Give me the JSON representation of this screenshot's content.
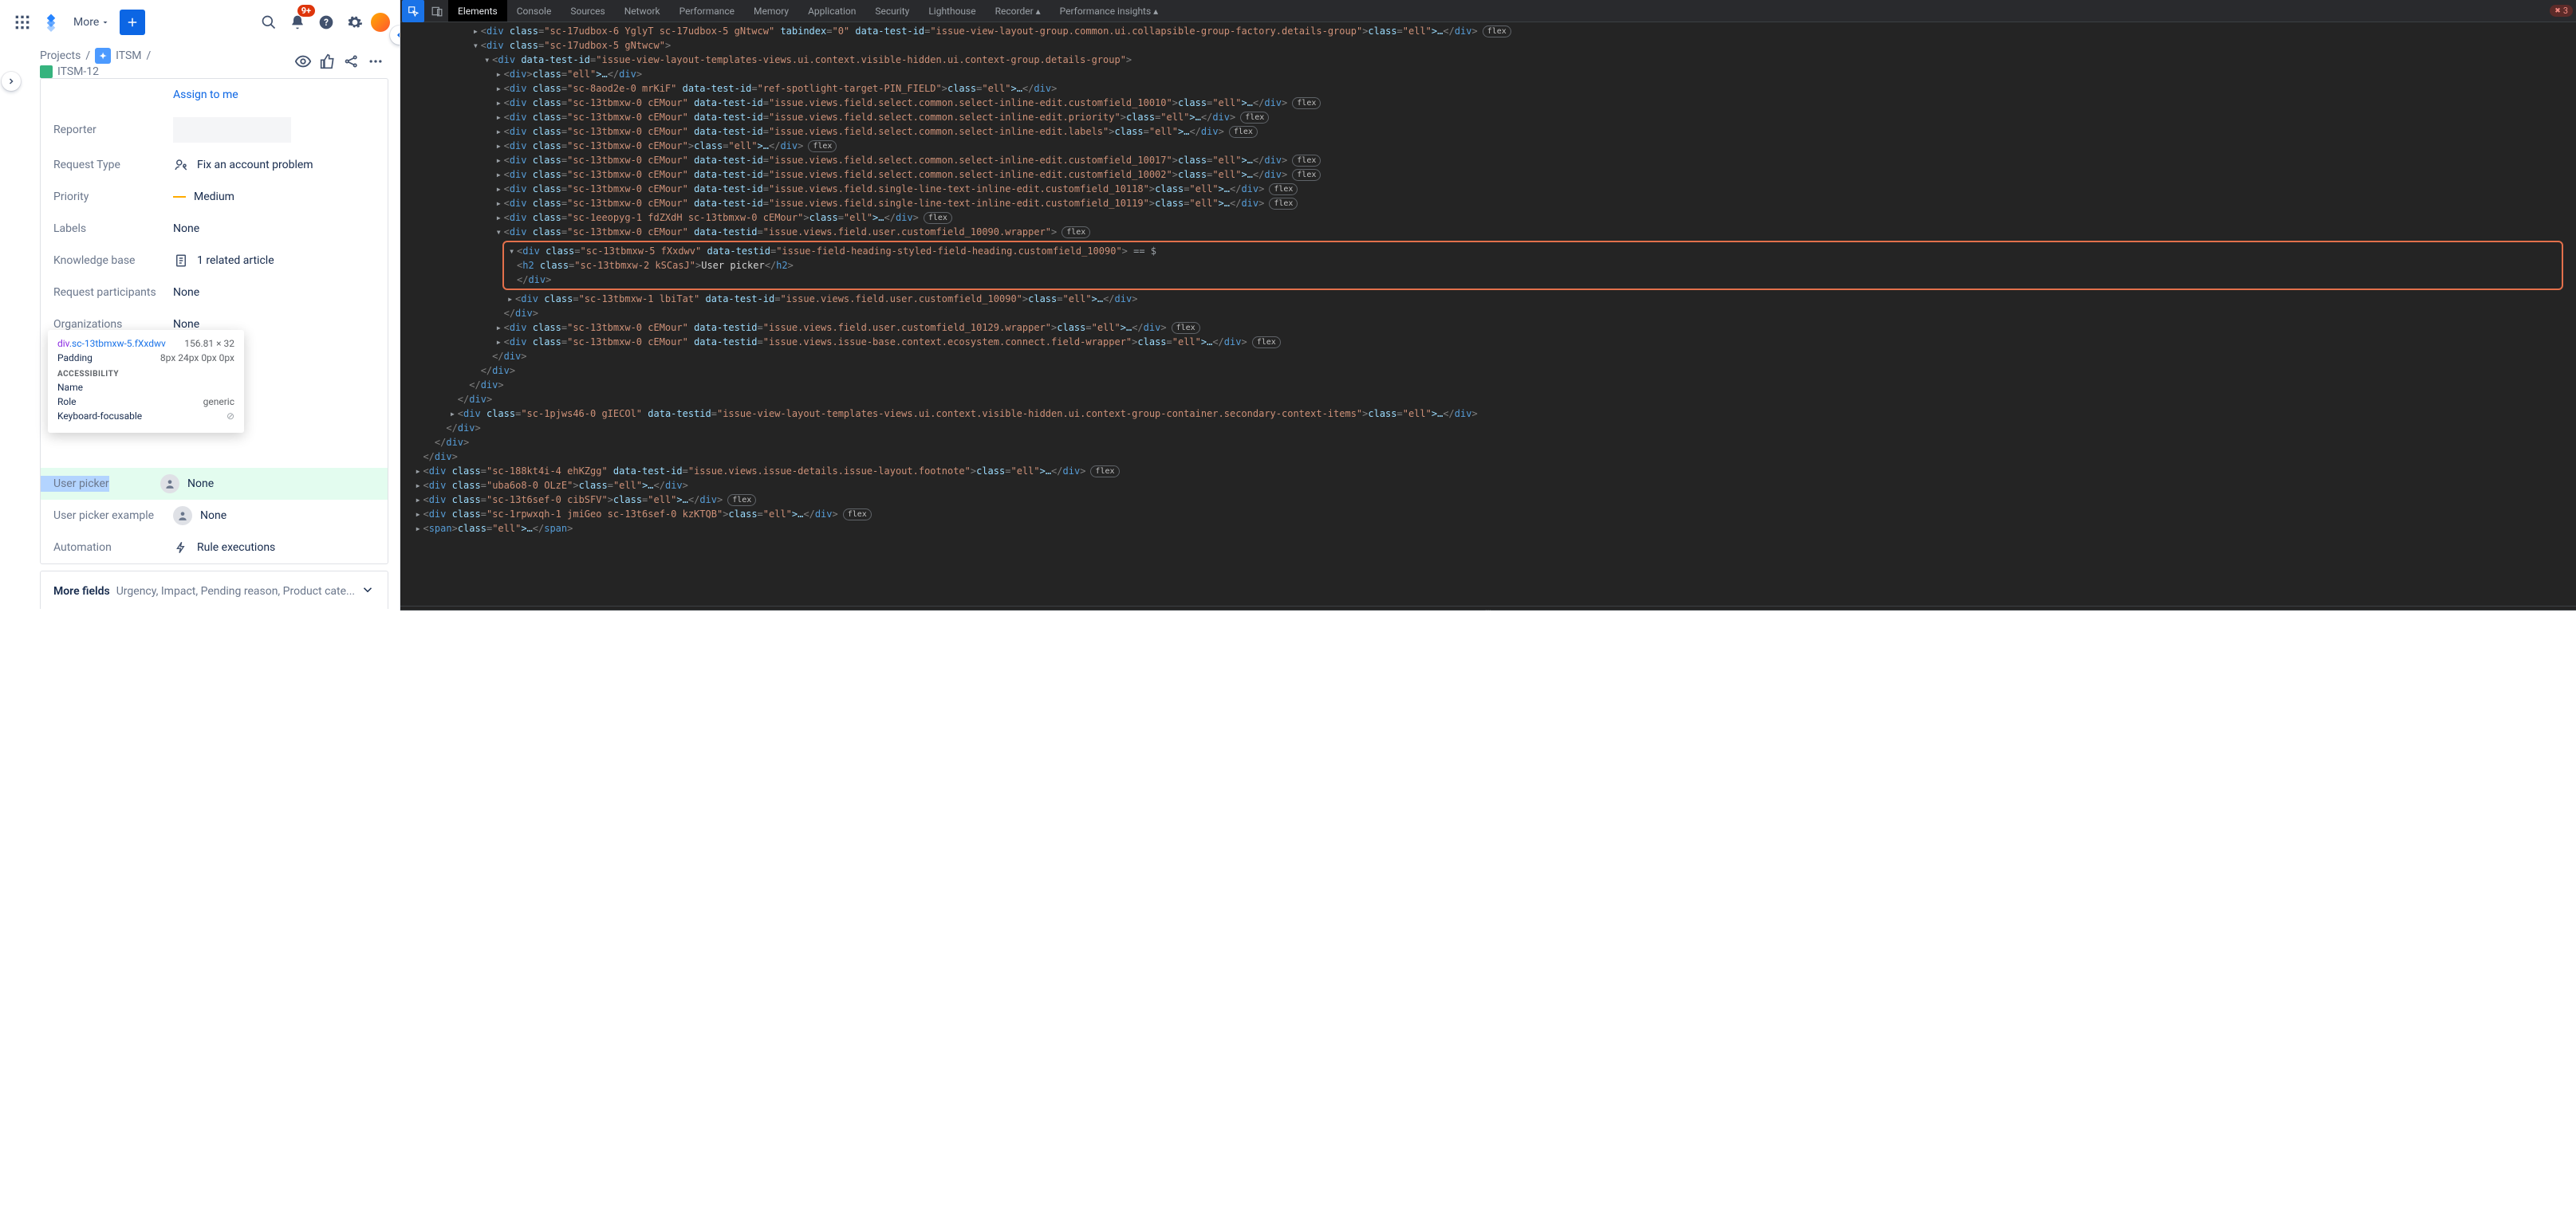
{
  "topbar": {
    "more": "More",
    "notif_badge": "9+"
  },
  "breadcrumb": {
    "projects": "Projects",
    "project_name": "ITSM",
    "issue_key": "ITSM-12"
  },
  "fields": {
    "assignee_label": "Assign to me",
    "reporter": {
      "label": "Reporter"
    },
    "request_type": {
      "label": "Request Type",
      "value": "Fix an account problem"
    },
    "priority": {
      "label": "Priority",
      "value": "Medium"
    },
    "labels": {
      "label": "Labels",
      "value": "None"
    },
    "knowledge": {
      "label": "Knowledge base",
      "value": "1 related article"
    },
    "participants": {
      "label": "Request participants",
      "value": "None"
    },
    "orgs": {
      "label": "Organizations",
      "value": "None"
    },
    "user_picker": {
      "label": "User picker",
      "value": "None"
    },
    "user_picker_ex": {
      "label": "User picker example",
      "value": "None"
    },
    "automation": {
      "label": "Automation",
      "value": "Rule executions"
    }
  },
  "more_fields": {
    "title": "More fields",
    "subtitle": "Urgency, Impact, Pending reason, Product cate..."
  },
  "tooltip": {
    "selector_prefix": "div",
    "selector_class": ".sc-13tbmxw-5.fXxdwv",
    "dims": "156.81 × 32",
    "padding_label": "Padding",
    "padding_value": "8px 24px 0px 0px",
    "a11y": "ACCESSIBILITY",
    "name_label": "Name",
    "role_label": "Role",
    "role_value": "generic",
    "focus_label": "Keyboard-focusable"
  },
  "devtools": {
    "tabs": [
      "Elements",
      "Console",
      "Sources",
      "Network",
      "Performance",
      "Memory",
      "Application",
      "Security",
      "Lighthouse",
      "Recorder ▴",
      "Performance insights ▴"
    ],
    "active_tab": 0,
    "error_count": "3"
  },
  "dom_lines": [
    {
      "indent": 6,
      "arrow": "▸",
      "html": "<div class=\"sc-17udbox-6 YglyT sc-17udbox-5 gNtwcw\" tabindex=\"0\" data-test-id=\"issue-view-layout-group.common.ui.collapsible-group-factory.details-group\">…</div>",
      "pill": "flex"
    },
    {
      "indent": 6,
      "arrow": "▾",
      "html": "<div class=\"sc-17udbox-5 gNtwcw\">"
    },
    {
      "indent": 7,
      "arrow": "▾",
      "html": "<div data-test-id=\"issue-view-layout-templates-views.ui.context.visible-hidden.ui.context-group.details-group\">"
    },
    {
      "indent": 8,
      "arrow": "▸",
      "html": "<div>…</div>"
    },
    {
      "indent": 8,
      "arrow": "▸",
      "html": "<div class=\"sc-8aod2e-0 mrKiF\" data-test-id=\"ref-spotlight-target-PIN_FIELD\">…</div>"
    },
    {
      "indent": 8,
      "arrow": "▸",
      "html": "<div class=\"sc-13tbmxw-0 cEMour\" data-test-id=\"issue.views.field.select.common.select-inline-edit.customfield_10010\">…</div>",
      "pill": "flex"
    },
    {
      "indent": 8,
      "arrow": "▸",
      "html": "<div class=\"sc-13tbmxw-0 cEMour\" data-test-id=\"issue.views.field.select.common.select-inline-edit.priority\">…</div>",
      "pill": "flex"
    },
    {
      "indent": 8,
      "arrow": "▸",
      "html": "<div class=\"sc-13tbmxw-0 cEMour\" data-test-id=\"issue.views.field.select.common.select-inline-edit.labels\">…</div>",
      "pill": "flex"
    },
    {
      "indent": 8,
      "arrow": "▸",
      "html": "<div class=\"sc-13tbmxw-0 cEMour\">…</div>",
      "pill": "flex"
    },
    {
      "indent": 8,
      "arrow": "▸",
      "html": "<div class=\"sc-13tbmxw-0 cEMour\" data-test-id=\"issue.views.field.select.common.select-inline-edit.customfield_10017\">…</div>",
      "pill": "flex"
    },
    {
      "indent": 8,
      "arrow": "▸",
      "html": "<div class=\"sc-13tbmxw-0 cEMour\" data-test-id=\"issue.views.field.select.common.select-inline-edit.customfield_10002\">…</div>",
      "pill": "flex"
    },
    {
      "indent": 8,
      "arrow": "▸",
      "html": "<div class=\"sc-13tbmxw-0 cEMour\" data-test-id=\"issue.views.field.single-line-text-inline-edit.customfield_10118\">…</div>",
      "pill": "flex"
    },
    {
      "indent": 8,
      "arrow": "▸",
      "html": "<div class=\"sc-13tbmxw-0 cEMour\" data-test-id=\"issue.views.field.single-line-text-inline-edit.customfield_10119\">…</div>",
      "pill": "flex"
    },
    {
      "indent": 8,
      "arrow": "▸",
      "html": "<div class=\"sc-1eeopyg-1 fdZXdH sc-13tbmxw-0 cEMour\">…</div>",
      "pill": "flex"
    },
    {
      "indent": 8,
      "arrow": "▾",
      "html": "<div class=\"sc-13tbmxw-0 cEMour\" data-testid=\"issue.views.field.user.customfield_10090.wrapper\">",
      "pill": "flex"
    },
    {
      "selected": true,
      "indent": 9,
      "arrow": "▾",
      "html": "<div class=\"sc-13tbmxw-5 fXxdwv\" data-testid=\"issue-field-heading-styled-field-heading.customfield_10090\">",
      "tail": " == $"
    },
    {
      "selected": true,
      "indent": 10,
      "arrow": "",
      "html": "<h2 class=\"sc-13tbmxw-2 kSCasJ\">User picker</h2>",
      "inner": "User picker"
    },
    {
      "selected": true,
      "indent": 9,
      "arrow": "",
      "html": "</div>"
    },
    {
      "indent": 9,
      "arrow": "▸",
      "html": "<div class=\"sc-13tbmxw-1 lbiTat\" data-test-id=\"issue.views.field.user.customfield_10090\">…</div>"
    },
    {
      "indent": 8,
      "arrow": "",
      "html": "</div>"
    },
    {
      "indent": 8,
      "arrow": "▸",
      "html": "<div class=\"sc-13tbmxw-0 cEMour\" data-testid=\"issue.views.field.user.customfield_10129.wrapper\">…</div>",
      "pill": "flex"
    },
    {
      "indent": 8,
      "arrow": "▸",
      "html": "<div class=\"sc-13tbmxw-0 cEMour\" data-testid=\"issue.views.issue-base.context.ecosystem.connect.field-wrapper\">…</div>",
      "pill": "flex"
    },
    {
      "indent": 7,
      "arrow": "",
      "html": "</div>"
    },
    {
      "indent": 6,
      "arrow": "",
      "html": "</div>"
    },
    {
      "indent": 5,
      "arrow": "",
      "html": "</div>"
    },
    {
      "indent": 4,
      "arrow": "",
      "html": "</div>"
    },
    {
      "indent": 4,
      "arrow": "▸",
      "html": "<div class=\"sc-1pjws46-0 gIECOl\" data-testid=\"issue-view-layout-templates-views.ui.context.visible-hidden.ui.context-group-container.secondary-context-items\">…</div>"
    },
    {
      "indent": 3,
      "arrow": "",
      "html": "</div>"
    },
    {
      "indent": 2,
      "arrow": "",
      "html": "</div>"
    },
    {
      "indent": 1,
      "arrow": "",
      "html": "</div>"
    },
    {
      "indent": 1,
      "arrow": "▸",
      "html": "<div class=\"sc-188kt4i-4 ehKZgg\" data-test-id=\"issue.views.issue-details.issue-layout.footnote\">…</div>",
      "pill": "flex"
    },
    {
      "indent": 1,
      "arrow": "▸",
      "html": "<div class=\"uba6o8-0 OLzE\">…</div>"
    },
    {
      "indent": 1,
      "arrow": "▸",
      "html": "<div class=\"sc-13t6sef-0 cibSFV\">…</div>",
      "pill": "flex"
    },
    {
      "indent": 1,
      "arrow": "▸",
      "html": "<div class=\"sc-1rpwxqh-1 jmiGeo sc-13t6sef-0 kzKTQB\">…</div>",
      "pill": "flex"
    },
    {
      "indent": 1,
      "arrow": "▸",
      "html": "<span>…</span>"
    }
  ]
}
